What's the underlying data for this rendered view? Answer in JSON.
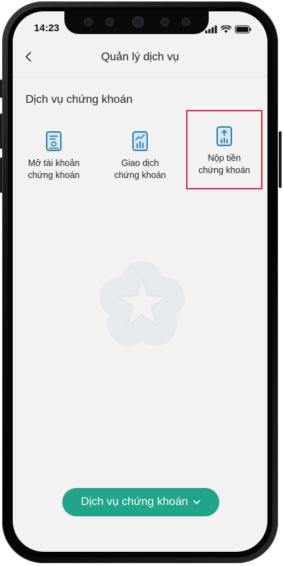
{
  "status_bar": {
    "time": "14:23",
    "icons": [
      "signal-icon",
      "wifi-icon",
      "battery-icon"
    ]
  },
  "header": {
    "title": "Quản lý dịch vụ",
    "back_icon": "chevron-left-icon"
  },
  "section": {
    "title": "Dịch vụ chứng khoán"
  },
  "services": [
    {
      "line1": "Mở tài khoản",
      "line2": "chứng khoán",
      "icon": "document-icon"
    },
    {
      "line1": "Giao dịch",
      "line2": "chứng khoán",
      "icon": "trading-chart-icon"
    },
    {
      "line1": "Nộp tiền",
      "line2": "chứng khoán",
      "icon": "deposit-icon",
      "highlighted": true
    }
  ],
  "bottom_button": {
    "label": "Dịch vụ chứng khoán",
    "icon": "chevron-down-icon"
  },
  "colors": {
    "accent": "#20a48a",
    "icon_blue": "#2f7fb0",
    "highlight": "#c9334f",
    "background": "#f2f2f2"
  }
}
